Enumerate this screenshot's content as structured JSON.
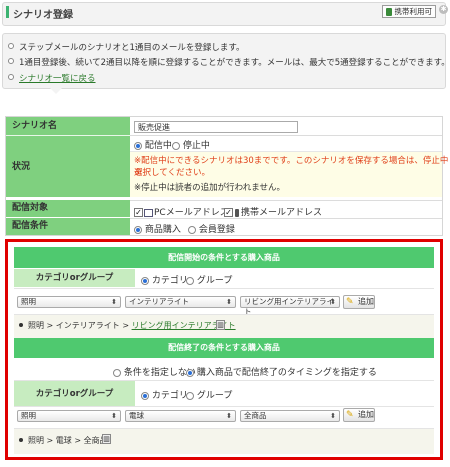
{
  "header": {
    "title": "シナリオ登録",
    "mobile_badge": "携帯利用可",
    "help_icon": "gear-icon"
  },
  "info": {
    "lines": [
      "ステップメールのシナリオと1通目のメールを登録します。",
      "1通目登録後、続いて2通目以降を順に登録することができます。メールは、最大で5通登録することができます。"
    ],
    "link": "シナリオ一覧に戻る"
  },
  "form": {
    "scenario_name": {
      "label": "シナリオ名",
      "value": "販売促進"
    },
    "status": {
      "label": "状況",
      "options": [
        "配信中",
        "停止中"
      ],
      "selected": "配信中",
      "warning_1": "※配信中にできるシナリオは30までです。このシナリオを保存する場合は、停止中を",
      "warning_2": "選択してください。",
      "note": "※停止中は読者の追加が行われません。"
    },
    "target": {
      "label": "配信対象",
      "options": [
        "PCメールアドレス",
        "携帯メールアドレス"
      ]
    },
    "condition": {
      "label": "配信条件",
      "options": [
        "商品購入",
        "会員登録"
      ],
      "selected": "商品購入"
    }
  },
  "start_section": {
    "title": "配信開始の条件とする購入商品",
    "category_label": "カテゴリorグループ",
    "options": [
      "カテゴリ",
      "グループ"
    ],
    "selected": "カテゴリ",
    "selects": [
      "照明",
      "インテリアライト",
      "リビング用インテリアライト"
    ],
    "add_label": "追加",
    "crumb_prefix": "照明 > インテリアライト > ",
    "crumb_link": "リビング用インテリアライト"
  },
  "end_section": {
    "title": "配信終了の条件とする購入商品",
    "mode_options": [
      "条件を指定しない",
      "購入商品で配信終了のタイミングを指定する"
    ],
    "mode_selected": "購入商品で配信終了のタイミングを指定する",
    "category_label": "カテゴリorグループ",
    "options": [
      "カテゴリ",
      "グループ"
    ],
    "selected": "カテゴリ",
    "selects": [
      "照明",
      "電球",
      "全商品"
    ],
    "add_label": "追加",
    "crumb": "照明 > 電球 > 全商品"
  },
  "colors": {
    "label_green": "#7fd07f",
    "section_green": "#4fc96f",
    "highlight_red": "#e00000",
    "warning_text": "#e0401a"
  }
}
